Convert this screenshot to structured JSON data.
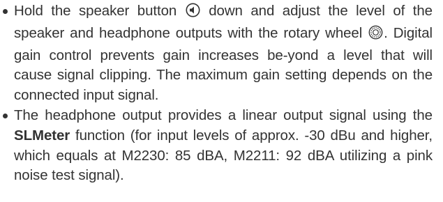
{
  "bullets": [
    {
      "parts": {
        "a": "Hold the speaker button",
        "icon1": "speaker-icon",
        "b": "down and adjust the level of the speaker and headphone outputs with the rotary wheel",
        "icon2": "rotary-wheel-icon",
        "c": ". Digital gain control prevents gain increases be-yond a level that will cause signal clipping. The maximum gain setting depends on the connected input signal."
      }
    },
    {
      "parts": {
        "a": "The headphone output provides a linear output signal using the",
        "bold": "SLMeter",
        "b": "function (for input levels of approx. -30 dBu and higher, which equals at M2230: 85 dBA, M2211: 92 dBA utilizing a pink noise test signal)."
      }
    }
  ]
}
